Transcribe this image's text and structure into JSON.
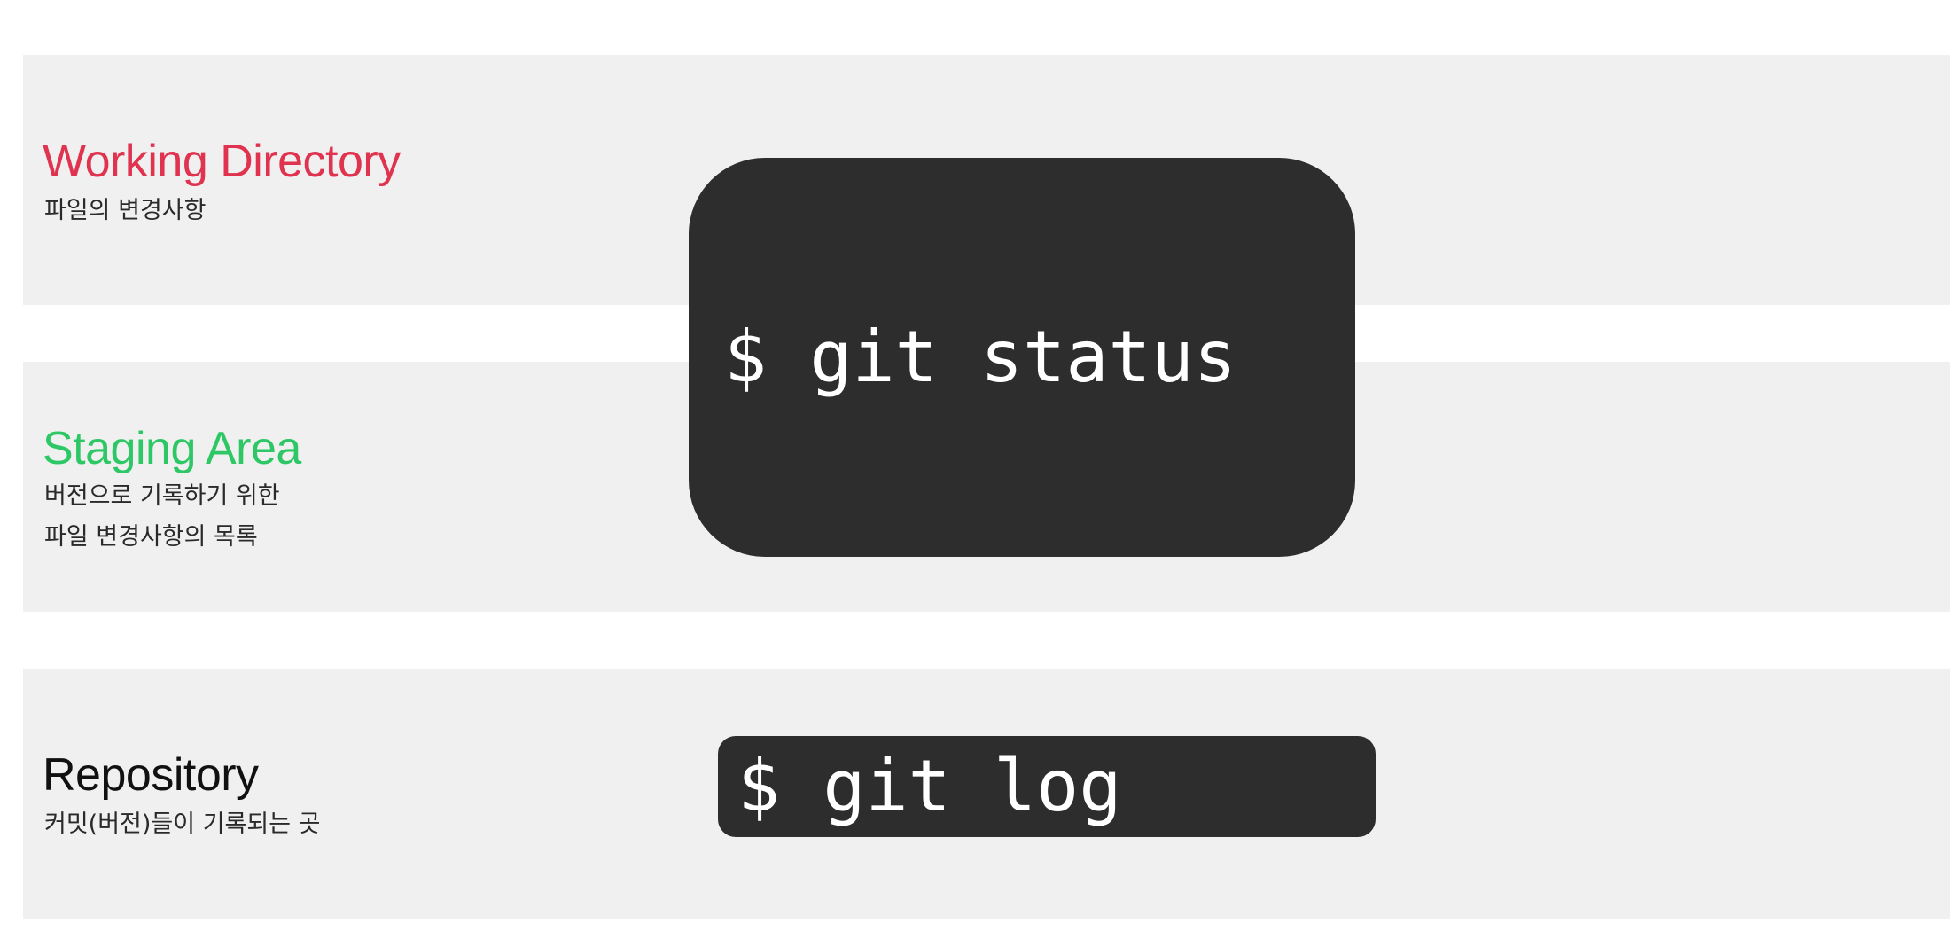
{
  "areas": {
    "working": {
      "title": "Working Directory",
      "description": "파일의 변경사항",
      "color": "#e0334f"
    },
    "staging": {
      "title": "Staging Area",
      "description_lines": [
        "버전으로 기록하기 위한",
        "파일 변경사항의 목록"
      ],
      "color": "#2ec766"
    },
    "repository": {
      "title": "Repository",
      "description": "커밋(버전)들이 기록되는 곳",
      "color": "#111111"
    }
  },
  "commands": {
    "status": "$ git status",
    "log": "$ git log"
  },
  "colors": {
    "band": "#f0f0f0",
    "terminal_bg": "#2d2d2d",
    "terminal_text": "#ffffff"
  }
}
